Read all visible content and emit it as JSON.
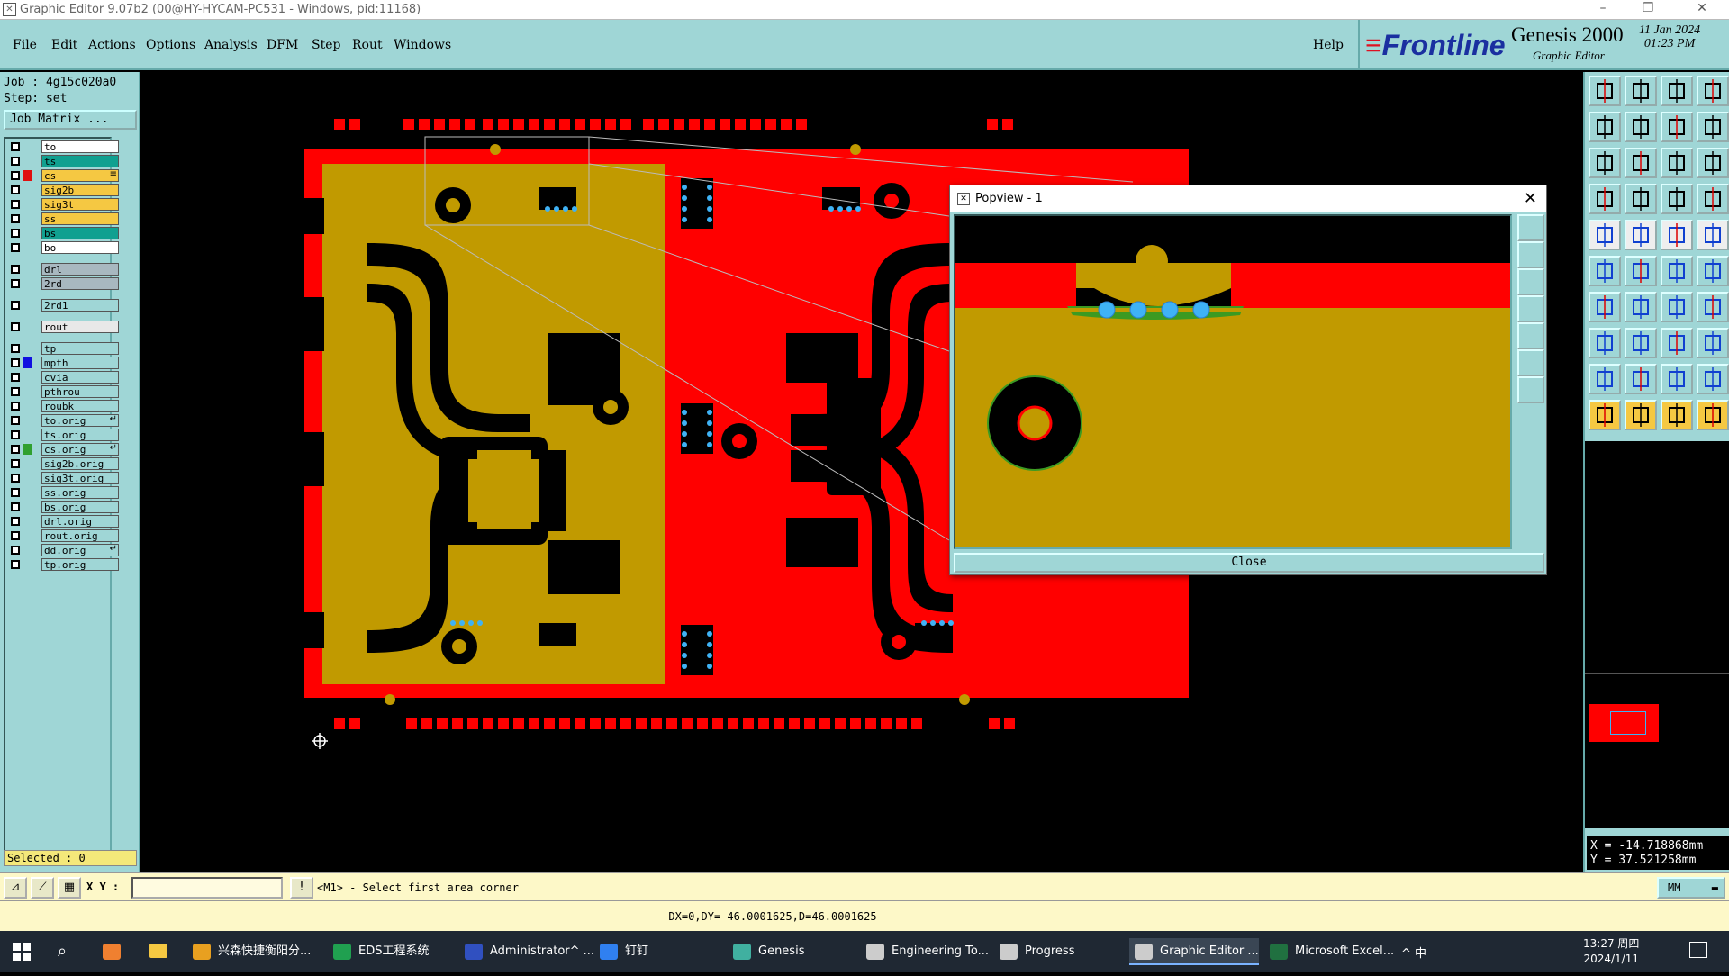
{
  "window": {
    "title": "Graphic Editor 9.07b2 (00@HY-HYCAM-PC531 - Windows, pid:11168)",
    "controls": [
      "–",
      "❐",
      "✕"
    ]
  },
  "menubar": {
    "items": [
      "File",
      "Edit",
      "Actions",
      "Options",
      "Analysis",
      "DFM",
      "Step",
      "Rout",
      "Windows"
    ],
    "help": "Help"
  },
  "brand": {
    "logo": "Frontline",
    "product": "Genesis 2000",
    "subtitle": "Graphic Editor",
    "date": "11 Jan 2024",
    "time": "01:23 PM"
  },
  "job": {
    "job_line": "Job : 4g15c020a0",
    "step_line": "Step: set",
    "matrix_button": "Job Matrix ..."
  },
  "layers": [
    {
      "name": "to",
      "color": "#ffffff",
      "swatch": "",
      "mark": ""
    },
    {
      "name": "ts",
      "color": "#10a090",
      "swatch": "",
      "mark": ""
    },
    {
      "name": "cs",
      "color": "#f5c842",
      "swatch": "#e01010",
      "mark": "≡"
    },
    {
      "name": "sig2b",
      "color": "#f5c842",
      "swatch": "",
      "mark": ""
    },
    {
      "name": "sig3t",
      "color": "#f5c842",
      "swatch": "",
      "mark": ""
    },
    {
      "name": "ss",
      "color": "#f5c842",
      "swatch": "",
      "mark": ""
    },
    {
      "name": "bs",
      "color": "#10a090",
      "swatch": "",
      "mark": ""
    },
    {
      "name": "bo",
      "color": "#ffffff",
      "swatch": "",
      "mark": ""
    },
    {
      "name": "drl",
      "color": "#a8b8c0",
      "swatch": "",
      "mark": ""
    },
    {
      "name": "2rd",
      "color": "#a8b8c0",
      "swatch": "",
      "mark": ""
    },
    {
      "name": "2rd1",
      "color": "#9fd6d6",
      "swatch": "",
      "mark": ""
    },
    {
      "name": "rout",
      "color": "#e8e8e8",
      "swatch": "",
      "mark": ""
    },
    {
      "name": "tp",
      "color": "#9fd6d6",
      "swatch": "",
      "mark": ""
    },
    {
      "name": "mpth",
      "color": "#9fd6d6",
      "swatch": "#1010e0",
      "mark": ""
    },
    {
      "name": "cvia",
      "color": "#9fd6d6",
      "swatch": "",
      "mark": ""
    },
    {
      "name": "pthrou",
      "color": "#9fd6d6",
      "swatch": "",
      "mark": ""
    },
    {
      "name": "roubk",
      "color": "#9fd6d6",
      "swatch": "",
      "mark": ""
    },
    {
      "name": "to.orig",
      "color": "#9fd6d6",
      "swatch": "",
      "mark": "↵"
    },
    {
      "name": "ts.orig",
      "color": "#9fd6d6",
      "swatch": "",
      "mark": ""
    },
    {
      "name": "cs.orig",
      "color": "#9fd6d6",
      "swatch": "#30a030",
      "mark": "↵"
    },
    {
      "name": "sig2b.orig",
      "color": "#9fd6d6",
      "swatch": "",
      "mark": ""
    },
    {
      "name": "sig3t.orig",
      "color": "#9fd6d6",
      "swatch": "",
      "mark": ""
    },
    {
      "name": "ss.orig",
      "color": "#9fd6d6",
      "swatch": "",
      "mark": ""
    },
    {
      "name": "bs.orig",
      "color": "#9fd6d6",
      "swatch": "",
      "mark": ""
    },
    {
      "name": "drl.orig",
      "color": "#9fd6d6",
      "swatch": "",
      "mark": ""
    },
    {
      "name": "rout.orig",
      "color": "#9fd6d6",
      "swatch": "",
      "mark": ""
    },
    {
      "name": "dd.orig",
      "color": "#9fd6d6",
      "swatch": "",
      "mark": "↵"
    },
    {
      "name": "tp.orig",
      "color": "#9fd6d6",
      "swatch": "",
      "mark": ""
    }
  ],
  "selected": "Selected : 0",
  "coords": {
    "x": "X = -14.718868mm",
    "y": "Y = 37.521258mm"
  },
  "cmd": {
    "xy_label": "X Y :",
    "input_value": "",
    "prompt": "<M1> - Select first area corner",
    "units": "MM"
  },
  "status": "DX=0,DY=-46.0001625,D=46.0001625",
  "popview": {
    "title": "Popview - 1",
    "close_label": "Close"
  },
  "colors": {
    "copper": "#c19a00",
    "mask": "#ff0000",
    "pad": "#3fb2f5",
    "ui": "#9fd6d6"
  },
  "taskbar": {
    "items": [
      {
        "label": "兴森快捷衡阳分...",
        "color": "#e8a020"
      },
      {
        "label": "EDS工程系统",
        "color": "#20a050"
      },
      {
        "label": "Administrator^ ...",
        "color": "#3050c0"
      },
      {
        "label": "钉钉",
        "color": "#3080f0"
      },
      {
        "label": "Genesis",
        "color": "#40b0a0"
      },
      {
        "label": "Engineering To...",
        "color": "#cccccc"
      },
      {
        "label": "Progress",
        "color": "#cccccc"
      },
      {
        "label": "Graphic Editor ...",
        "color": "#cccccc"
      },
      {
        "label": "Microsoft Excel...",
        "color": "#207040"
      }
    ],
    "tray": "^ 中",
    "time": "13:27 周四",
    "date": "2024/1/11"
  }
}
